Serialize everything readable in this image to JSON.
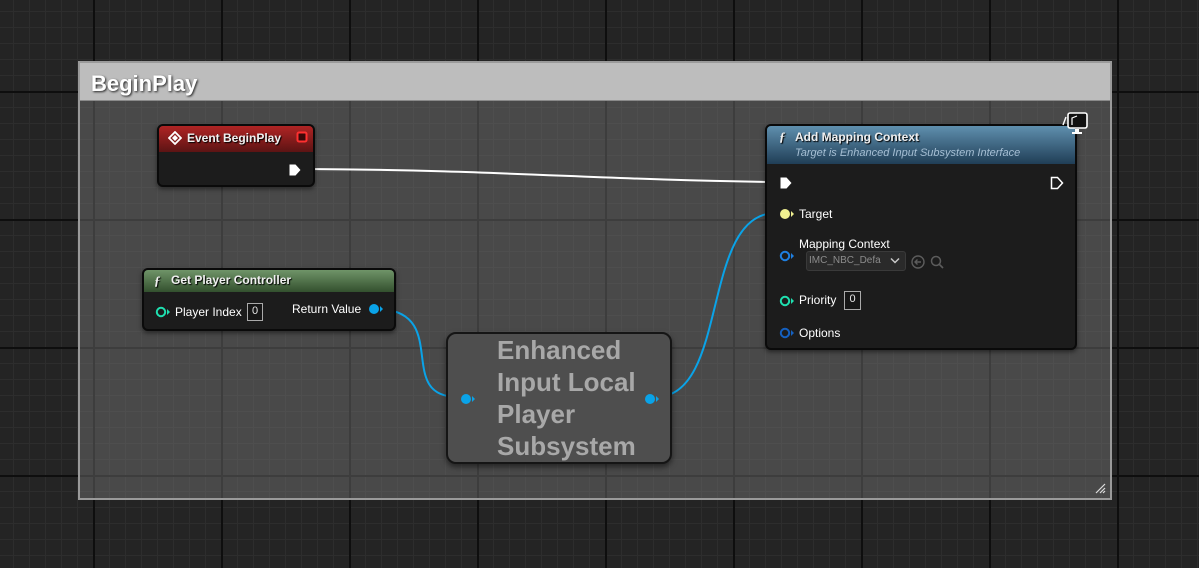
{
  "comment": {
    "title": "BeginPlay"
  },
  "event_node": {
    "title": "Event BeginPlay"
  },
  "get_player_controller": {
    "title": "Get Player Controller",
    "player_index_label": "Player Index",
    "player_index_value": "0",
    "return_value_label": "Return Value"
  },
  "subsystem_node": {
    "title_lines": [
      "Enhanced",
      "Input Local",
      "Player",
      "Subsystem"
    ]
  },
  "add_mapping_context": {
    "title": "Add Mapping Context",
    "subtitle": "Target is Enhanced Input Subsystem Interface",
    "target_label": "Target",
    "mapping_context_label": "Mapping Context",
    "mapping_context_value": "IMC_NBC_Defa",
    "priority_label": "Priority",
    "priority_value": "0",
    "options_label": "Options"
  },
  "colors": {
    "exec": "#ffffff",
    "object_pin": "#00a8f0",
    "int_pin": "#1fe0b0",
    "struct_pin": "#0060c8",
    "self_pin": "#f0f090",
    "event_header": "#8a1a1a",
    "pure_header": "#4e6e46",
    "function_header": "#2e5a78"
  }
}
